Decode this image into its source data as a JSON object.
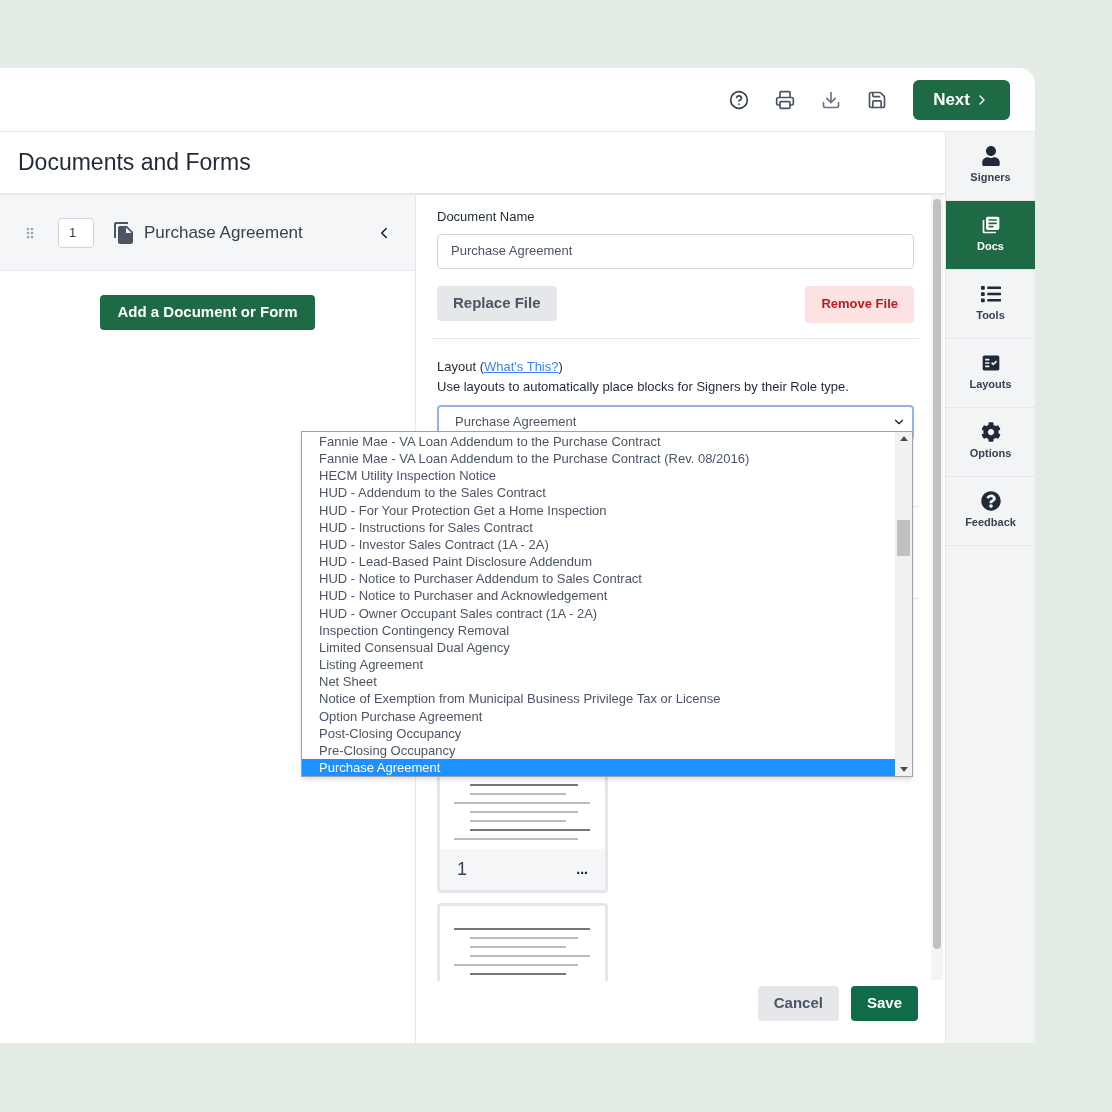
{
  "header": {
    "next_button": "Next"
  },
  "page_title": "Documents and Forms",
  "documents": [
    {
      "order": "1",
      "name": "Purchase Agreement"
    }
  ],
  "add_button": "Add a Document or Form",
  "form": {
    "document_name_label": "Document Name",
    "document_name_value": "Purchase Agreement",
    "replace_button": "Replace File",
    "remove_button": "Remove File",
    "layout_label_before": "Layout (",
    "layout_link": "What's This?",
    "layout_label_after": ")",
    "layout_description": "Use layouts to automatically place blocks for Signers by their Role type.",
    "layout_select_value": "Purchase Agreement",
    "layout_options": [
      {
        "label": "Fannie Mae - VA Loan Addendum to the Purchase Contract",
        "selected": false
      },
      {
        "label": "Fannie Mae - VA Loan Addendum to the Purchase Contract (Rev. 08/2016)",
        "selected": false
      },
      {
        "label": "HECM Utility Inspection Notice",
        "selected": false
      },
      {
        "label": "HUD - Addendum to the Sales Contract",
        "selected": false
      },
      {
        "label": "HUD - For Your Protection Get a Home Inspection",
        "selected": false
      },
      {
        "label": "HUD - Instructions for Sales Contract",
        "selected": false
      },
      {
        "label": "HUD - Investor Sales Contract (1A - 2A)",
        "selected": false
      },
      {
        "label": "HUD - Lead-Based Paint Disclosure Addendum",
        "selected": false
      },
      {
        "label": "HUD - Notice to Purchaser Addendum to Sales Contract",
        "selected": false
      },
      {
        "label": "HUD - Notice to Purchaser and Acknowledgement",
        "selected": false
      },
      {
        "label": "HUD - Owner Occupant Sales contract (1A - 2A)",
        "selected": false
      },
      {
        "label": "Inspection Contingency Removal",
        "selected": false
      },
      {
        "label": "Limited Consensual Dual Agency",
        "selected": false
      },
      {
        "label": "Listing Agreement",
        "selected": false
      },
      {
        "label": "Net Sheet",
        "selected": false
      },
      {
        "label": "Notice of Exemption from Municipal Business Privilege Tax or License",
        "selected": false
      },
      {
        "label": "Option Purchase Agreement",
        "selected": false
      },
      {
        "label": "Post-Closing Occupancy",
        "selected": false
      },
      {
        "label": "Pre-Closing Occupancy",
        "selected": false
      },
      {
        "label": "Purchase Agreement",
        "selected": true
      }
    ],
    "pages": [
      {
        "kind": "numbered",
        "number": "1",
        "menu": "..."
      },
      {
        "kind": "plain"
      }
    ],
    "cancel_button": "Cancel",
    "save_button": "Save"
  },
  "sidebar": {
    "items": [
      {
        "label": "Signers",
        "selected": false
      },
      {
        "label": "Docs",
        "selected": true
      },
      {
        "label": "Tools",
        "selected": false
      },
      {
        "label": "Layouts",
        "selected": false
      },
      {
        "label": "Options",
        "selected": false
      },
      {
        "label": "Feedback",
        "selected": false
      }
    ]
  }
}
